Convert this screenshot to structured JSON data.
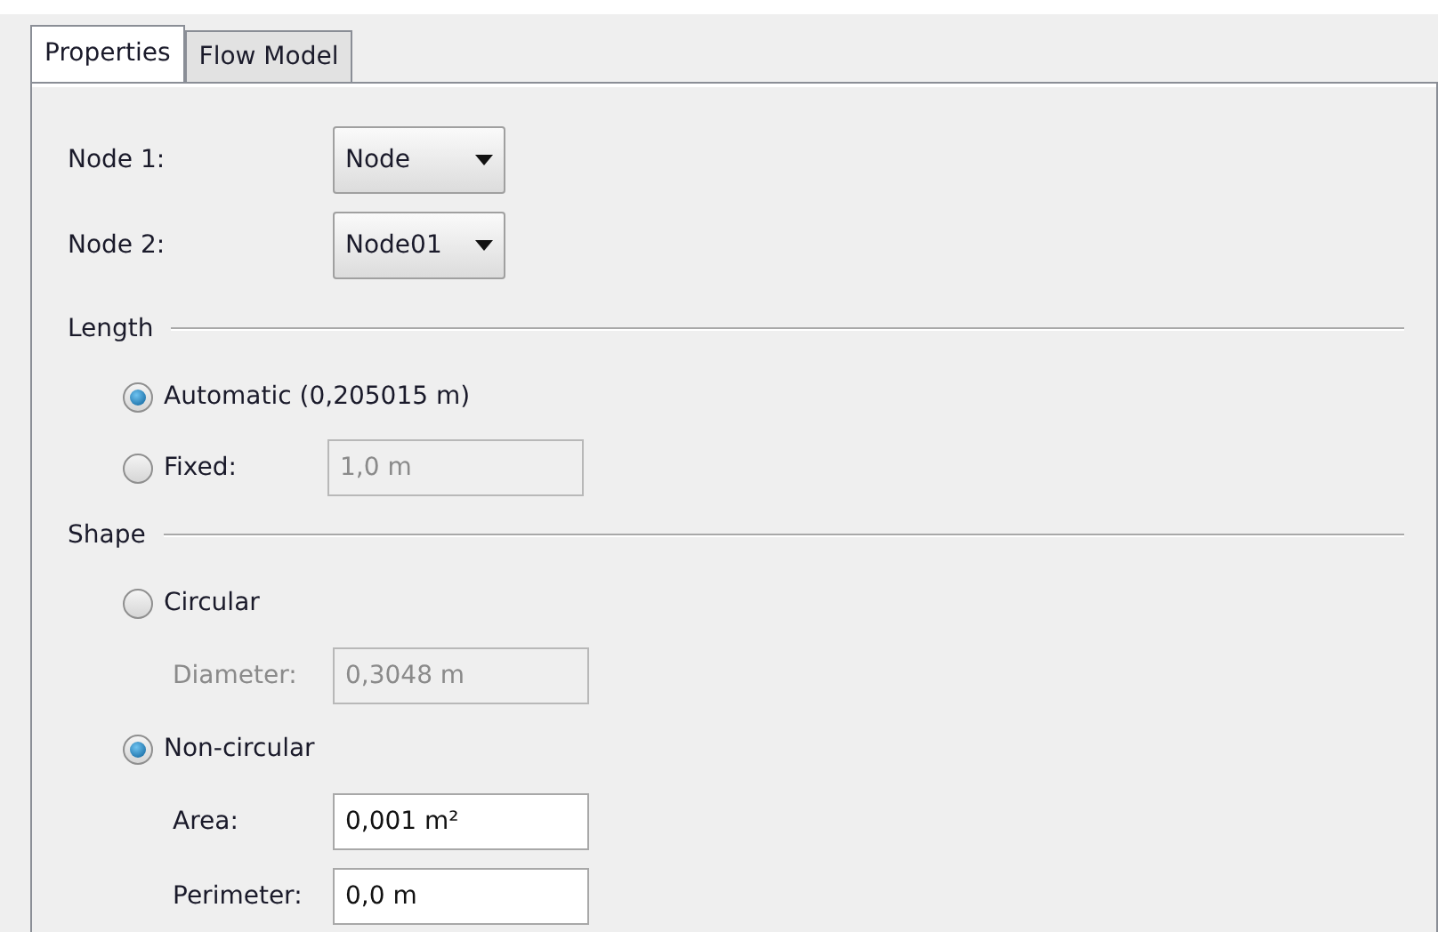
{
  "tabs": [
    {
      "label": "Properties",
      "selected": true
    },
    {
      "label": "Flow Model",
      "selected": false
    }
  ],
  "combos": [
    {
      "label": "Node 1:",
      "value": "Node"
    },
    {
      "label": "Node 2:",
      "value": "Node01"
    }
  ],
  "sections": [
    {
      "title": "Length",
      "options": [
        {
          "label": "Automatic (0,205015 m)",
          "selected": true
        },
        {
          "label": "Fixed:",
          "selected": false,
          "inline_field": {
            "value": "1,0 m",
            "disabled": true
          }
        }
      ]
    },
    {
      "title": "Shape",
      "options": [
        {
          "label": "Circular",
          "selected": false,
          "fields": [
            {
              "label": "Diameter:",
              "value": "0,3048 m",
              "disabled": true
            }
          ]
        },
        {
          "label": "Non-circular",
          "selected": true,
          "fields": [
            {
              "label": "Area:",
              "value": "0,001 m²",
              "disabled": false
            },
            {
              "label": "Perimeter:",
              "value": "0,0 m",
              "disabled": false
            }
          ]
        }
      ]
    }
  ]
}
